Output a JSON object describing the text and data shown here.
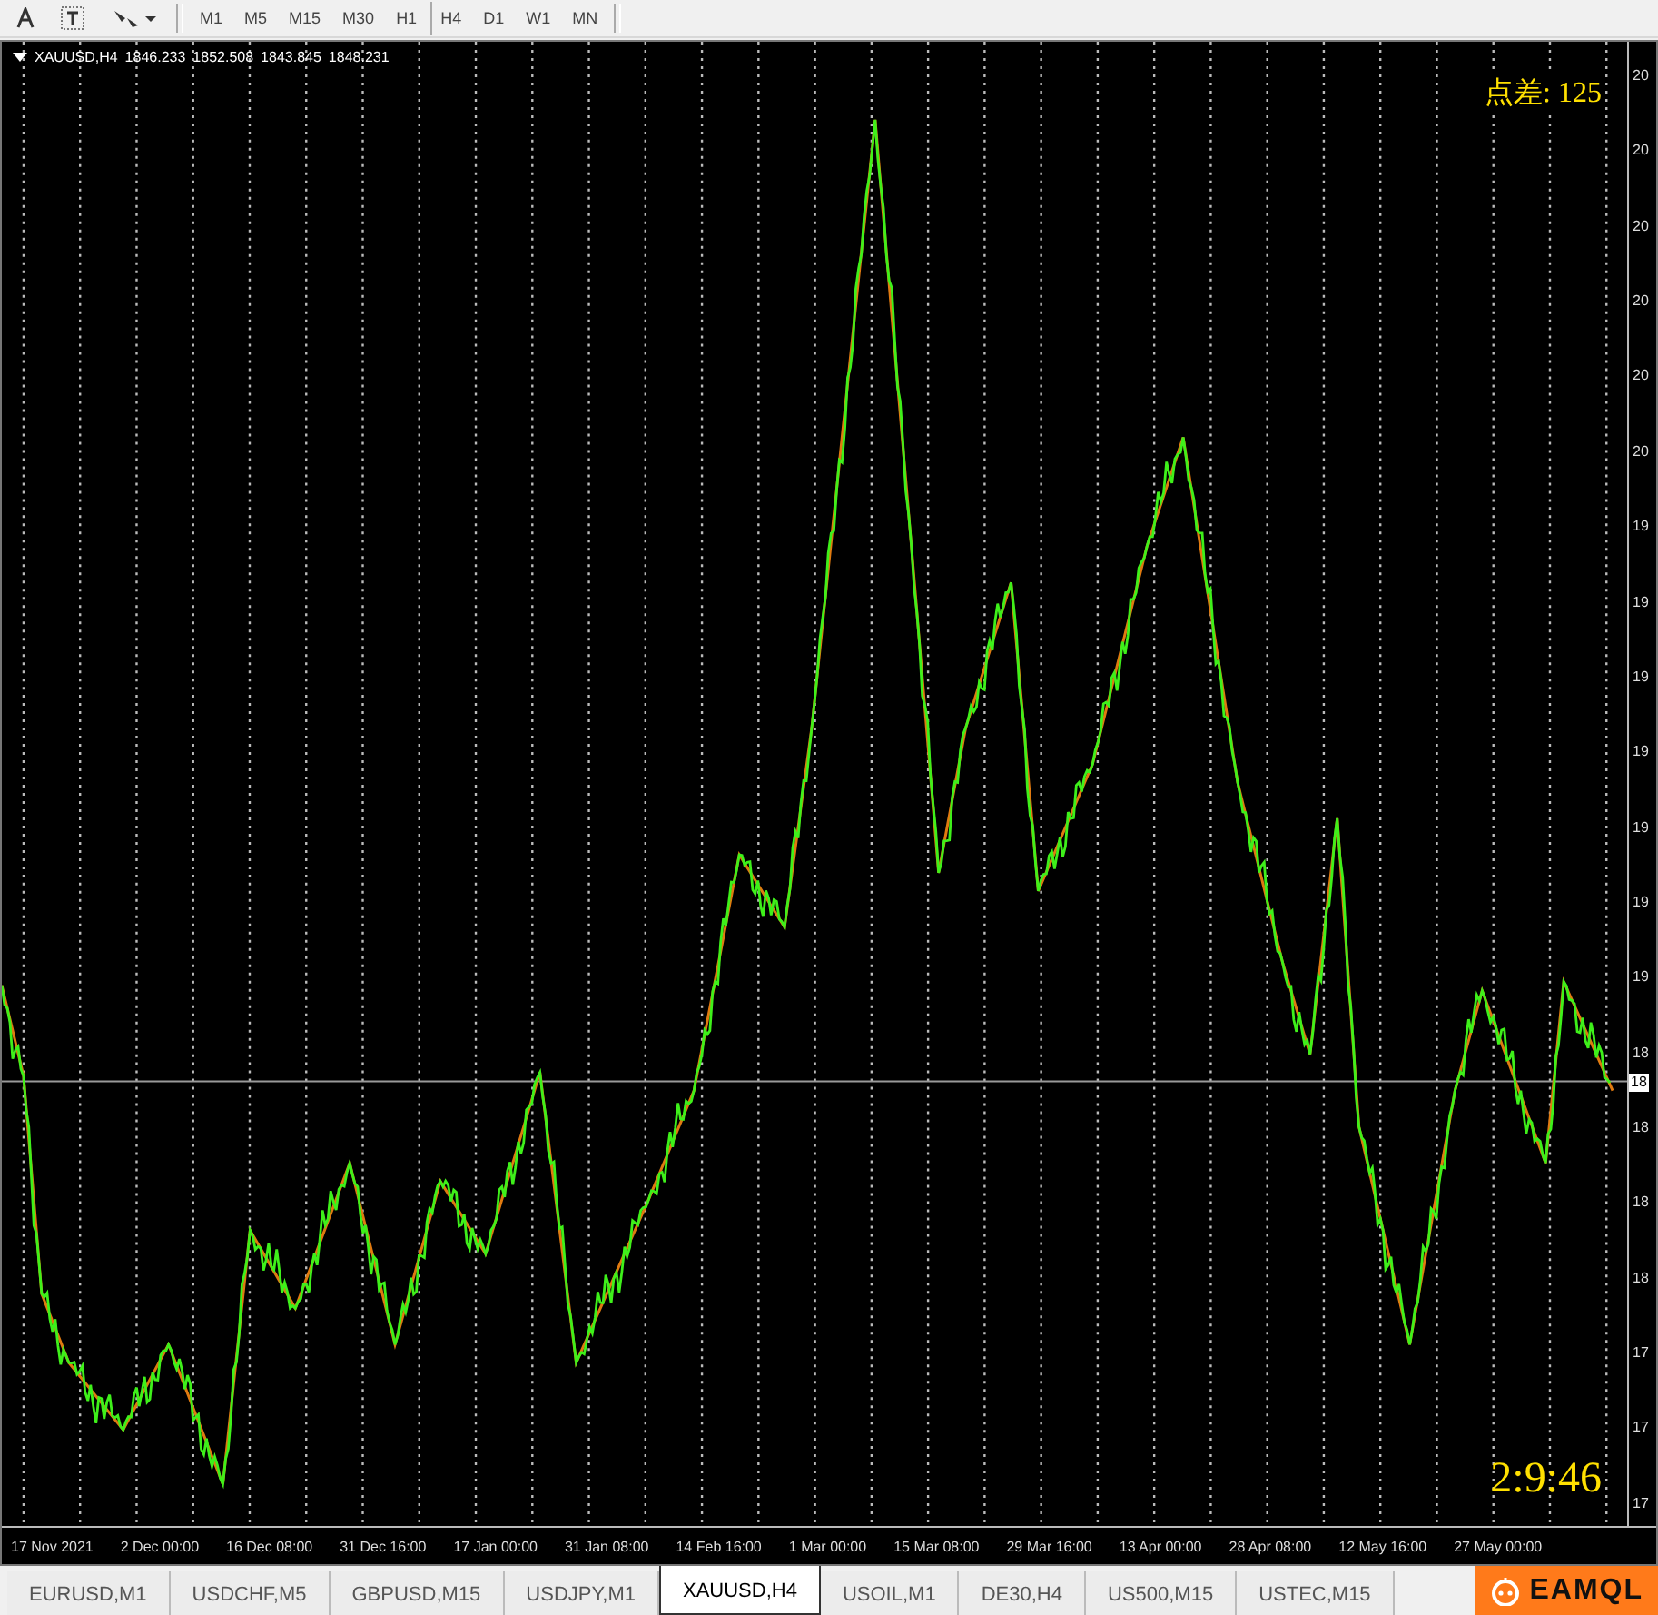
{
  "toolbar": {
    "timeframes": [
      "M1",
      "M5",
      "M15",
      "M30",
      "H1",
      "H4",
      "D1",
      "W1",
      "MN"
    ]
  },
  "chart": {
    "symbol": "XAUUSD,H4",
    "prices": [
      "1846.233",
      "1852.508",
      "1843.845",
      "1848.231"
    ],
    "spread": "点差: 125",
    "timer": "2:9:46",
    "price_axis": [
      "20",
      "20",
      "20",
      "20",
      "20",
      "20",
      "19",
      "19",
      "19",
      "19",
      "19",
      "19",
      "19",
      "18",
      "18",
      "18",
      "18",
      "17",
      "17",
      "17"
    ],
    "price_marker": "18",
    "time_axis": [
      "17 Nov 2021",
      "2 Dec 00:00",
      "16 Dec 08:00",
      "31 Dec 16:00",
      "17 Jan 00:00",
      "31 Jan 08:00",
      "14 Feb 16:00",
      "1 Mar 00:00",
      "15 Mar 08:00",
      "29 Mar 16:00",
      "13 Apr 00:00",
      "28 Apr 08:00",
      "12 May 16:00",
      "27 May 00:00"
    ]
  },
  "tabs": [
    {
      "label": "EURUSD,M1",
      "selected": false
    },
    {
      "label": "USDCHF,M5",
      "selected": false
    },
    {
      "label": "GBPUSD,M15",
      "selected": false
    },
    {
      "label": "USDJPY,M1",
      "selected": false
    },
    {
      "label": "XAUUSD,H4",
      "selected": true
    },
    {
      "label": "USOIL,M1",
      "selected": false
    },
    {
      "label": "DE30,H4",
      "selected": false
    },
    {
      "label": "US500,M15",
      "selected": false
    },
    {
      "label": "USTEC,M15",
      "selected": false
    }
  ],
  "logo": "EAMQL"
}
